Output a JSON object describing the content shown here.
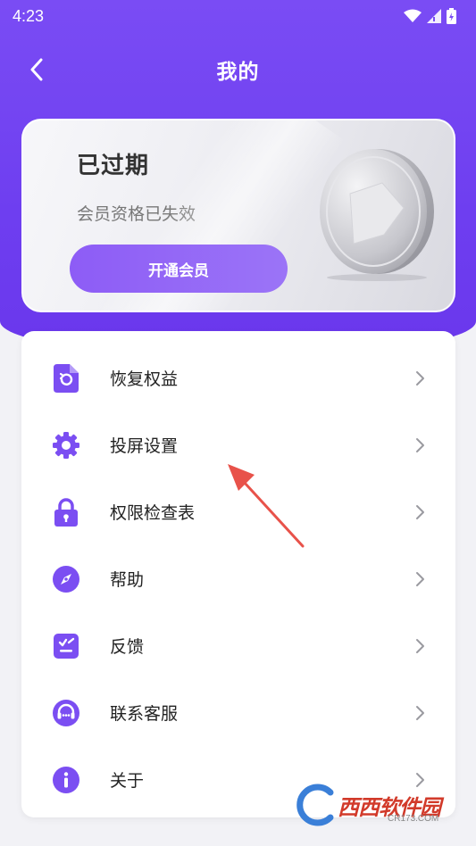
{
  "status_bar": {
    "time": "4:23"
  },
  "nav": {
    "title": "我的"
  },
  "vip_card": {
    "status": "已过期",
    "description": "会员资格已失效",
    "button_label": "开通会员"
  },
  "menu": {
    "items": [
      {
        "label": "恢复权益",
        "icon": "restore-icon"
      },
      {
        "label": "投屏设置",
        "icon": "gear-icon"
      },
      {
        "label": "权限检查表",
        "icon": "lock-icon"
      },
      {
        "label": "帮助",
        "icon": "compass-icon"
      },
      {
        "label": "反馈",
        "icon": "feedback-icon"
      },
      {
        "label": "联系客服",
        "icon": "headset-icon"
      },
      {
        "label": "关于",
        "icon": "info-icon"
      }
    ]
  },
  "watermark": {
    "text": "西西软件园",
    "sub": "CR173.COM"
  },
  "colors": {
    "primary": "#6e3ef0",
    "accent": "#8d5cf6",
    "icon": "#7b4ef2",
    "annotation_arrow": "#e8524a"
  }
}
